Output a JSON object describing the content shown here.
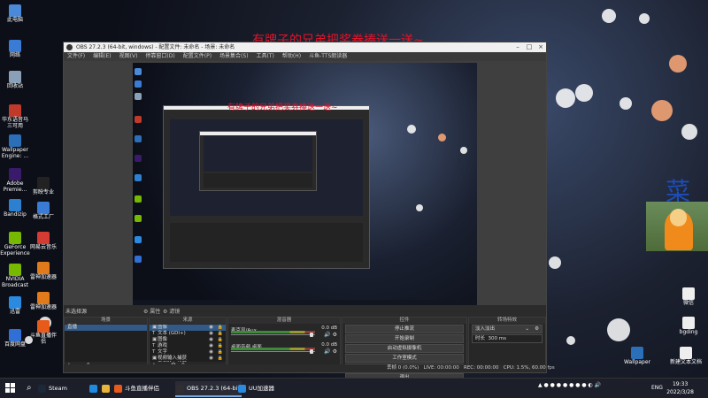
{
  "banner": "有牌子的兄弟把奖券捧送一送~",
  "nested_banner": "有牌子的兄弟把奖券捧送一送~",
  "char_small": "菜",
  "char_big": "菜",
  "desktop_icons_left": [
    {
      "label": "此电脑",
      "icon": "pc-icon",
      "color": "#4a8ad8"
    },
    {
      "label": "网络",
      "icon": "network-icon",
      "color": "#3a7bd5"
    },
    {
      "label": "回收站",
      "icon": "recycle-bin-icon",
      "color": "#8aa0b8"
    },
    {
      "label": "华东语音马三可用",
      "icon": "app-icon",
      "color": "#c0392b"
    },
    {
      "label": "Wallpaper Engine: ...",
      "icon": "wallpaper-engine-icon",
      "color": "#2a6fb8"
    },
    {
      "label": "Adobe Premie...",
      "icon": "premiere-icon",
      "color": "#3a1a6a"
    },
    {
      "label": "Bandizip",
      "icon": "bandizip-icon",
      "color": "#2d7fd0"
    },
    {
      "label": "GeForce Experience",
      "icon": "geforce-icon",
      "color": "#76b900"
    },
    {
      "label": "NVIDIA Broadcast",
      "icon": "nvidia-broadcast-icon",
      "color": "#76b900"
    },
    {
      "label": "迅雷",
      "icon": "thunder-icon",
      "color": "#2a8ae0"
    },
    {
      "label": "百度网盘",
      "icon": "baidu-netdisk-icon",
      "color": "#2f6fd6"
    }
  ],
  "desktop_icons_col2": [
    {
      "label": "剪映专业",
      "icon": "jianying-icon",
      "color": "#222"
    },
    {
      "label": "格式工厂",
      "icon": "format-factory-icon",
      "color": "#3a7bd5"
    },
    {
      "label": "网易云音乐",
      "icon": "netease-music-icon",
      "color": "#d43c33"
    },
    {
      "label": "雷神加速器",
      "icon": "leishen-icon",
      "color": "#e07a1a"
    },
    {
      "label": "雷神加速器",
      "icon": "leishen2-icon",
      "color": "#e07a1a"
    },
    {
      "label": "斗鱼直播伴侣",
      "icon": "douyu-icon",
      "color": "#e85a1a"
    }
  ],
  "desktop_icons_right": [
    {
      "label": "微信",
      "icon": "document-icon",
      "color": "#eeeeee"
    },
    {
      "label": "bgding",
      "icon": "document-icon-2",
      "color": "#eeeeee"
    },
    {
      "label": "Wallpaper",
      "icon": "wallpaper-icon",
      "color": "#2a6fb8"
    },
    {
      "label": "新建文本文档",
      "icon": "text-doc-icon",
      "color": "#eeeeee"
    }
  ],
  "obs": {
    "title": "OBS 27.2.3 (64-bit, windows) - 配置文件: 未命名 - 场景: 未命名",
    "menu": [
      "文件(F)",
      "编辑(E)",
      "视图(V)",
      "停靠窗口(D)",
      "配置文件(P)",
      "场景集合(S)",
      "工具(T)",
      "帮助(H)",
      "斗鱼-TTS朗读器"
    ],
    "scene_label": "未选择源",
    "radio_props": "属性",
    "radio_filters": "滤镜",
    "docks": {
      "scenes_title": "场景",
      "sources_title": "来源",
      "mixer_title": "混音器",
      "controls_title": "控件",
      "transitions_title": "转场特效"
    },
    "scenes": [
      "直播"
    ],
    "sources": [
      {
        "name": "图像",
        "tag": "▣"
      },
      {
        "name": "文本 (GDI+)",
        "tag": "T"
      },
      {
        "name": "图像",
        "tag": "▣"
      },
      {
        "name": "游戏",
        "tag": "T"
      },
      {
        "name": "文字",
        "tag": "T"
      },
      {
        "name": "视频输入捕获",
        "tag": "▣"
      },
      {
        "name": "音频输入捕获",
        "tag": "♪"
      },
      {
        "name": "图片",
        "tag": "▣"
      },
      {
        "name": "显示器捕获",
        "tag": "▭"
      },
      {
        "name": "视频文本",
        "tag": "T"
      },
      {
        "name": "视频文本",
        "tag": "T"
      }
    ],
    "mixer": [
      {
        "name": "麦克风/Aux",
        "db": "0.0 dB"
      },
      {
        "name": "桌面音频 桌面",
        "db": "0.0 dB"
      }
    ],
    "controls": [
      "停止推流",
      "开始录制",
      "启动虚拟摄像机",
      "工作室模式",
      "设置",
      "退出"
    ],
    "transition": {
      "value": "淡入淡出",
      "duration_label": "时长",
      "duration": "300 ms"
    },
    "status": {
      "dropped": "丢帧 0 (0.0%)",
      "live": "LIVE: 00:00:00",
      "rec": "REC: 00:00:00",
      "cpu": "CPU: 1.5%, 60.00 fps"
    }
  },
  "taskbar": {
    "apps": [
      {
        "label": "Steam",
        "icon": "steam-icon",
        "color": "#1b2838"
      },
      {
        "label": "斗鱼直播伴侣",
        "icon": "douyu-task-icon",
        "color": "#e85a1a"
      },
      {
        "label": "OBS 27.2.3 (64-bit...",
        "icon": "obs-icon",
        "color": "#302e31"
      },
      {
        "label": "UU加速器",
        "icon": "uu-icon",
        "color": "#2a8ae0"
      }
    ],
    "lang": "ENG",
    "time": "19:33",
    "date": "2022/3/28"
  }
}
